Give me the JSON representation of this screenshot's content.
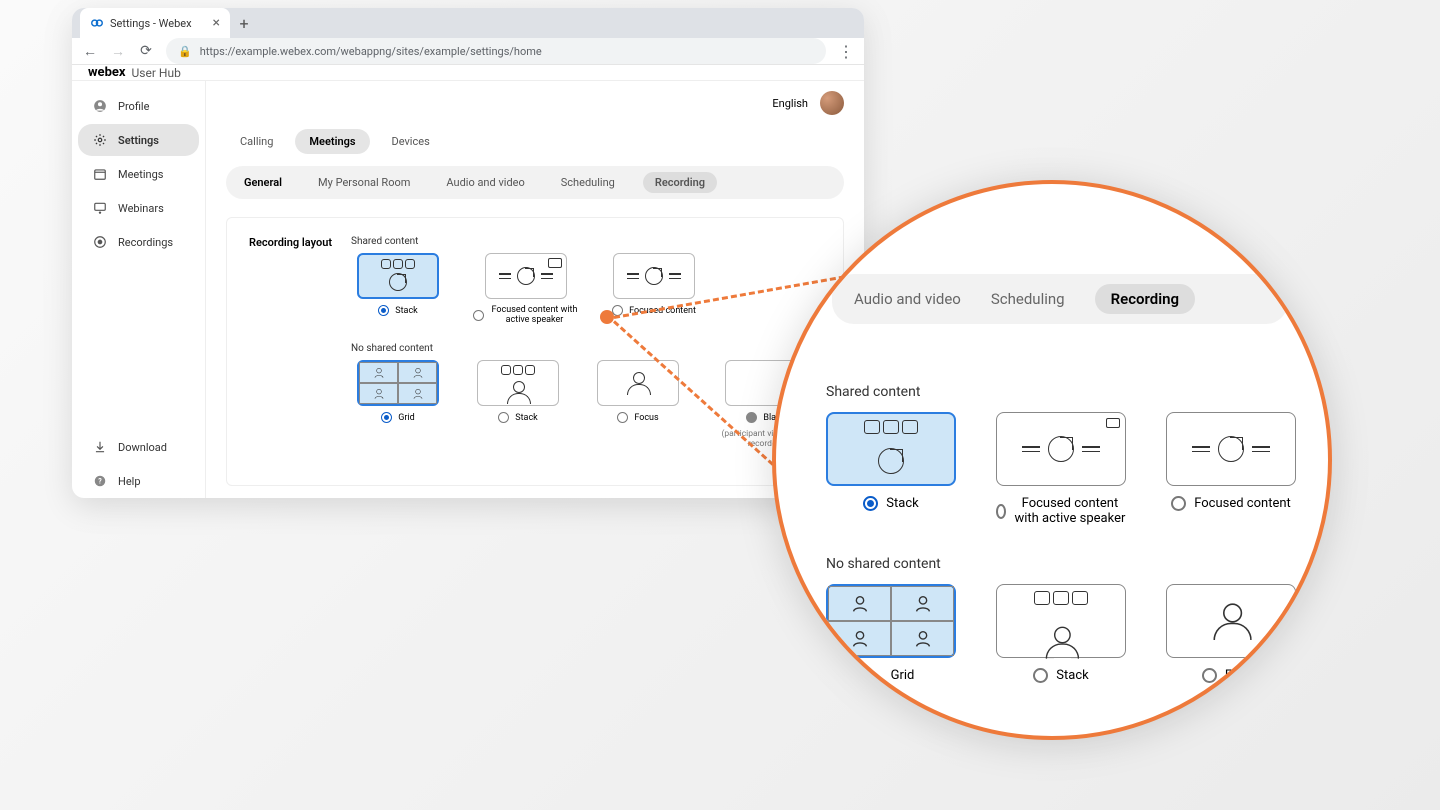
{
  "browser": {
    "tab_title": "Settings - Webex",
    "url": "https://example.webex.com/webappng/sites/example/settings/home"
  },
  "app": {
    "brand": "webex",
    "hub": "User Hub",
    "language": "English"
  },
  "sidebar": {
    "items": [
      {
        "label": "Profile"
      },
      {
        "label": "Settings"
      },
      {
        "label": "Meetings"
      },
      {
        "label": "Webinars"
      },
      {
        "label": "Recordings"
      }
    ],
    "footer": [
      {
        "label": "Download"
      },
      {
        "label": "Help"
      }
    ]
  },
  "tabs": {
    "items": [
      {
        "label": "Calling"
      },
      {
        "label": "Meetings"
      },
      {
        "label": "Devices"
      }
    ]
  },
  "subtabs": {
    "items": [
      {
        "label": "General"
      },
      {
        "label": "My Personal Room"
      },
      {
        "label": "Audio and video"
      },
      {
        "label": "Scheduling"
      },
      {
        "label": "Recording"
      }
    ]
  },
  "recording": {
    "section_label": "Recording layout",
    "shared": {
      "heading": "Shared content",
      "options": [
        {
          "label": "Stack"
        },
        {
          "label": "Focused content with active speaker"
        },
        {
          "label": "Focused content"
        }
      ]
    },
    "no_shared": {
      "heading": "No shared content",
      "options": [
        {
          "label": "Grid"
        },
        {
          "label": "Stack"
        },
        {
          "label": "Focus"
        },
        {
          "label": "Blank"
        }
      ],
      "blank_note": "(participant video is not recorded)"
    }
  },
  "magnifier": {
    "subtabs": [
      {
        "label": "Audio and video"
      },
      {
        "label": "Scheduling"
      },
      {
        "label": "Recording"
      }
    ],
    "shared_heading": "Shared content",
    "shared_options": [
      {
        "label": "Stack"
      },
      {
        "label": "Focused content with active speaker"
      },
      {
        "label": "Focused content"
      }
    ],
    "no_shared_heading": "No shared content",
    "no_shared_options": [
      {
        "label": "Grid"
      },
      {
        "label": "Stack"
      },
      {
        "label": "Focus"
      }
    ]
  }
}
